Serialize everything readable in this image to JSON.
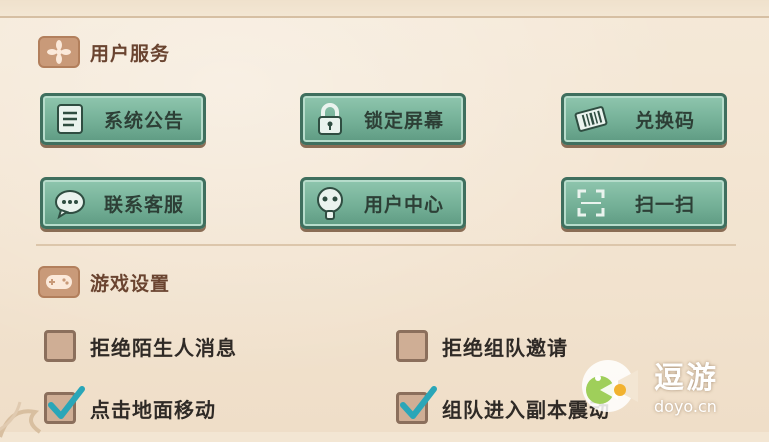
{
  "user_services": {
    "title": "用户服务",
    "buttons": [
      {
        "label": "系统公告",
        "icon": "notice-icon"
      },
      {
        "label": "锁定屏幕",
        "icon": "lock-icon"
      },
      {
        "label": "兑换码",
        "icon": "ticket-icon"
      },
      {
        "label": "联系客服",
        "icon": "chat-icon"
      },
      {
        "label": "用户中心",
        "icon": "user-icon"
      },
      {
        "label": "扫一扫",
        "icon": "scan-icon"
      }
    ]
  },
  "game_settings": {
    "title": "游戏设置",
    "options": [
      {
        "label": "拒绝陌生人消息",
        "checked": false
      },
      {
        "label": "拒绝组队邀请",
        "checked": false
      },
      {
        "label": "点击地面移动",
        "checked": true
      },
      {
        "label": "组队进入副本震动",
        "checked": true
      }
    ]
  },
  "watermark": {
    "name": "逗游",
    "url": "doyo.cn"
  },
  "colors": {
    "button_fill": "#74b097",
    "button_border": "#3f6f5e",
    "section_icon": "#c99a79",
    "check": "#2aa6b8"
  }
}
